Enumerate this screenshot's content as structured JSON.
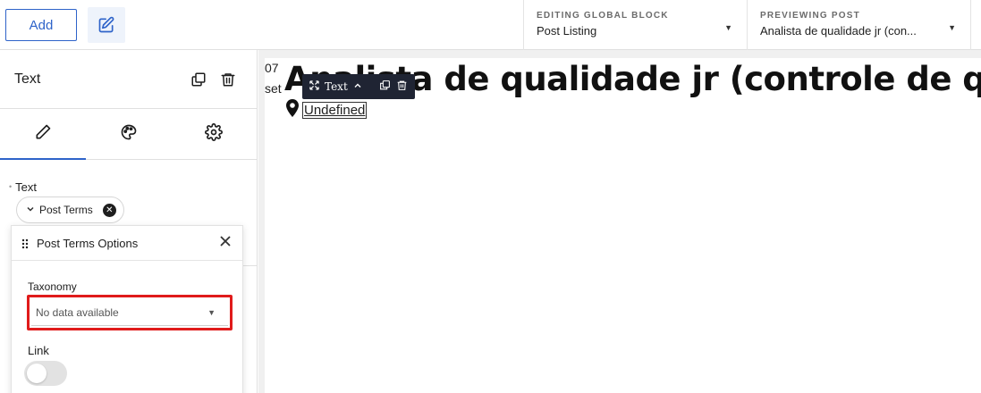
{
  "topbar": {
    "add_label": "Add",
    "editing": {
      "label": "EDITING GLOBAL BLOCK",
      "value": "Post Listing"
    },
    "previewing": {
      "label": "PREVIEWING POST",
      "value": "Analista de qualidade jr (con..."
    }
  },
  "panel": {
    "title": "Text",
    "tabs": [
      "content",
      "style",
      "settings"
    ],
    "text_field_label": "Text",
    "chip_label": "Post Terms"
  },
  "popover": {
    "title": "Post Terms Options",
    "taxonomy_label": "Taxonomy",
    "taxonomy_value": "No data available",
    "link_label": "Link",
    "link_enabled": false
  },
  "canvas": {
    "date_day": "07",
    "date_month": "set",
    "post_title": "Analista de qualidade jr (controle de qualidade)",
    "location_text": "Undefined",
    "toolbar_label": "Text"
  },
  "colors": {
    "accent": "#2e63c9",
    "highlight": "#e01b1b",
    "toolbar_bg": "#1f2433"
  }
}
